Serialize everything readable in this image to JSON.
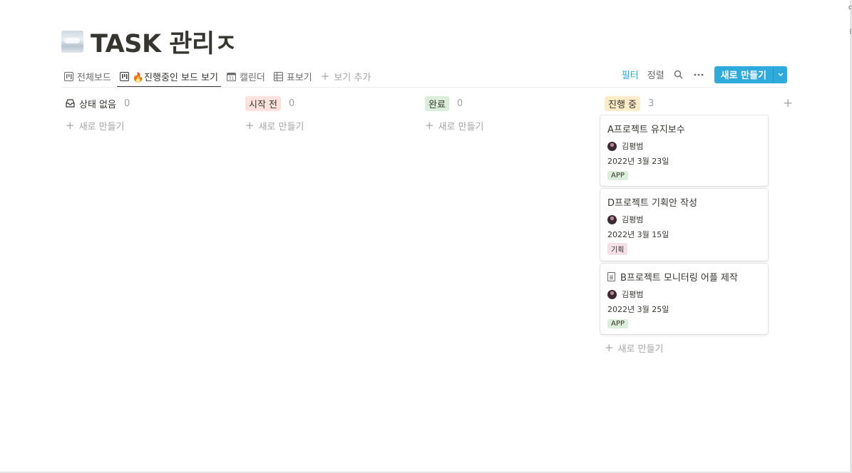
{
  "page": {
    "title": "TASK 관리ㅈ",
    "icon": "cloud-icon"
  },
  "tabs": [
    {
      "label": "전체보드",
      "icon": "board-icon",
      "active": false
    },
    {
      "label": "🔥진행중인 보드 보기",
      "icon": "board-icon",
      "active": true
    },
    {
      "label": "캘린더",
      "icon": "calendar-icon",
      "active": false
    },
    {
      "label": "표보기",
      "icon": "table-icon",
      "active": false
    }
  ],
  "add_view_label": "보기 추가",
  "toolbar": {
    "filter_label": "필터",
    "sort_label": "정렬",
    "new_label": "새로 만들기",
    "accent_color": "#2eaadc"
  },
  "columns": [
    {
      "label": "상태 없음",
      "count": "0",
      "color": "",
      "add_label": "새로 만들기"
    },
    {
      "label": "시작 전",
      "count": "0",
      "color": "#ffe2dd",
      "add_label": "새로 만들기"
    },
    {
      "label": "완료",
      "count": "0",
      "color": "#dbeddb",
      "add_label": "새로 만들기"
    },
    {
      "label": "진행 중",
      "count": "3",
      "color": "#fdecc8",
      "add_label": "새로 만들기"
    }
  ],
  "cards": [
    {
      "title": "A프로젝트 유지보수",
      "person": "김평범",
      "date": "2022년 3월 23일",
      "tag": "APP",
      "tag_color": "#dbeddb",
      "has_doc_icon": false
    },
    {
      "title": "D프로젝트 기획안 작성",
      "person": "김평범",
      "date": "2022년 3월 15일",
      "tag": "기획",
      "tag_color": "#f5e0e9",
      "has_doc_icon": false
    },
    {
      "title": "B프로젝트 모니터링 어플 제작",
      "person": "김평범",
      "date": "2022년 3월 25일",
      "tag": "APP",
      "tag_color": "#dbeddb",
      "has_doc_icon": true
    }
  ]
}
